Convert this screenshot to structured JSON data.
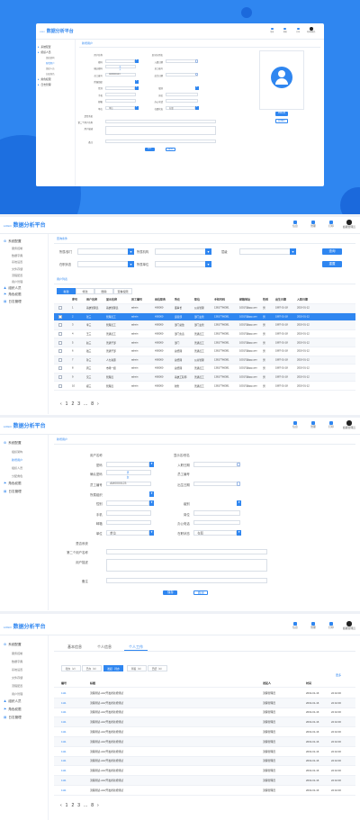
{
  "app": {
    "title": "数据分析平台",
    "title_prefix": "LOGO"
  },
  "header_icons": [
    {
      "icon": "message-icon",
      "label": "信息"
    },
    {
      "icon": "tools-icon",
      "label": "管理"
    },
    {
      "icon": "mail-icon",
      "label": "打印"
    },
    {
      "icon": "avatar",
      "label": "超级管理员"
    }
  ],
  "sidebar": [
    {
      "label": "系统配置",
      "icon": "gear-icon",
      "type": "group"
    },
    {
      "label": "服务控制",
      "type": "sub"
    },
    {
      "label": "数据字典",
      "type": "sub"
    },
    {
      "label": "系统设置",
      "type": "sub"
    },
    {
      "label": "文件存储",
      "type": "sub"
    },
    {
      "label": "流程配置",
      "type": "sub"
    },
    {
      "label": "用户管理",
      "type": "sub"
    },
    {
      "label": "组织人员",
      "icon": "users-icon",
      "type": "group"
    },
    {
      "label": "角色权限",
      "icon": "shield-icon",
      "type": "group"
    },
    {
      "label": "日志管理",
      "icon": "log-icon",
      "type": "group"
    }
  ],
  "sidebar_s3": [
    {
      "label": "系统配置",
      "icon": "gear-icon",
      "type": "group"
    },
    {
      "label": "组织架构",
      "type": "sub"
    },
    {
      "label": "新增用户",
      "type": "sub",
      "active": true
    },
    {
      "label": "组织人员",
      "type": "sub"
    },
    {
      "label": "分配角色",
      "type": "sub"
    },
    {
      "label": "角色权限",
      "icon": "shield-icon",
      "type": "group"
    },
    {
      "label": "日志管理",
      "icon": "log-icon",
      "type": "group"
    }
  ],
  "hero_sidebar": [
    {
      "label": "系统配置",
      "type": "group"
    },
    {
      "label": "组织人员",
      "type": "group"
    },
    {
      "label": "组织架构",
      "type": "sub"
    },
    {
      "label": "新增用户",
      "type": "sub",
      "active": true
    },
    {
      "label": "组织人员",
      "type": "sub"
    },
    {
      "label": "分配角色",
      "type": "sub"
    },
    {
      "label": "角色权限",
      "type": "group"
    },
    {
      "label": "日志管理",
      "type": "group"
    }
  ],
  "form": {
    "panel_title": "新增用户",
    "labels": {
      "user_id": "用户名称",
      "password": "密码",
      "confirm": "确认密码",
      "user_code": "员工编号",
      "pos_rank": "所属组织",
      "gender": "性别",
      "phone": "手机",
      "email": "邮箱",
      "org": "单位",
      "sys_admin": "是否系统",
      "alt_user": "第二个用户名称",
      "desc": "用户描述",
      "remark": "备注",
      "nick": "显示名/别名",
      "join": "入职日期",
      "emp_no": "员工编号",
      "birth": "出生日期",
      "level": "级别",
      "post": "岗位",
      "office": "办公电话",
      "addr": "地址",
      "status": "在职状态"
    },
    "values": {
      "user_code": "AM0000123",
      "status": "在职",
      "org": "单位"
    },
    "dd_text": {
      "a": "男",
      "b": "女"
    },
    "buttons": {
      "save": "保存",
      "cancel": "取消"
    },
    "avatar_buttons": {
      "upload": "更换头像",
      "choose": "选择图片"
    }
  },
  "search": {
    "panel_title": "查询条件",
    "fields": [
      {
        "label": "所属/部门"
      },
      {
        "label": "所属机构"
      },
      {
        "label": "层级"
      },
      {
        "label": "在职状态"
      },
      {
        "label": "所属单位"
      }
    ],
    "buttons": {
      "query": "查询",
      "reset": "重置"
    }
  },
  "list": {
    "panel_title": "用户列表",
    "tabs": [
      "新建",
      "修改",
      "删除",
      "查看权限"
    ],
    "columns": [
      "序号",
      "用户名称",
      "显示名称",
      "员工编号",
      "岗位职务",
      "所在",
      "职位",
      "手机号码",
      "邮箱地址",
      "性别",
      "出生日期",
      "入职日期"
    ],
    "rows": [
      [
        "1",
        "系统管理员",
        "系统管理员",
        "admin",
        "H00000",
        "董事长",
        "公共管理",
        "13817766381",
        "10017@jpg.com",
        "男",
        "1987-01-18",
        "2019-01-12"
      ],
      [
        "2",
        "张三",
        "管理员工",
        "admin",
        "H00000",
        "运营部",
        "部门主管",
        "13817766381",
        "10017@jpg.com",
        "男",
        "1987-01-18",
        "2019-01-12"
      ],
      [
        "3",
        "李三",
        "管理员工",
        "admin",
        "H00000",
        "部门总监",
        "部门主管",
        "13817766381",
        "10017@jpg.com",
        "男",
        "1987-01-18",
        "2019-01-12"
      ],
      [
        "4",
        "王三",
        "普通员工",
        "admin",
        "H00000",
        "部门负责",
        "普通员工",
        "13817766381",
        "10017@jpg.com",
        "男",
        "1987-01-18",
        "2019-01-12"
      ],
      [
        "5",
        "赵三",
        "普通干部",
        "admin",
        "H00000",
        "部门",
        "普通员工",
        "13817766381",
        "10017@jpg.com",
        "男",
        "1987-01-18",
        "2019-01-12"
      ],
      [
        "6",
        "钱三",
        "普通干部",
        "admin",
        "H00000",
        "总经理",
        "普通员工",
        "13817766381",
        "10017@jpg.com",
        "男",
        "1987-01-18",
        "2019-01-12"
      ],
      [
        "7",
        "孙三",
        "人力资源",
        "admin",
        "H00000",
        "总经理",
        "公共管理",
        "13817766381",
        "10017@jpg.com",
        "男",
        "1987-01-18",
        "2019-01-12"
      ],
      [
        "8",
        "周三",
        "市场一组",
        "admin",
        "H00000",
        "总经理",
        "普通员工",
        "13817766381",
        "10017@jpg.com",
        "男",
        "1987-01-18",
        "2019-01-12"
      ],
      [
        "9",
        "吴三",
        "管理员",
        "admin",
        "H00000",
        "系统工程师",
        "普通员工",
        "13817766381",
        "10017@jpg.com",
        "男",
        "1987-01-18",
        "2019-01-12"
      ],
      [
        "10",
        "郑三",
        "管理员",
        "admin",
        "H00000",
        "财务",
        "普通员工",
        "13817766381",
        "10017@jpg.com",
        "男",
        "1987-01-18",
        "2019-01-12"
      ]
    ],
    "pager": {
      "prev": "‹",
      "pages": [
        "1",
        "2",
        "3",
        "...",
        "8"
      ],
      "next": "›"
    }
  },
  "profile": {
    "tabs": [
      "基本信息",
      "个人信息",
      "个人工作"
    ],
    "filters": [
      "待办（2）",
      "已办（0）",
      "发起 · 待办",
      "草稿（0）",
      "已结（0）"
    ],
    "more": "更多",
    "columns": [
      "编号",
      "标题",
      "发起人",
      "时间"
    ],
    "rows": [
      [
        "1111",
        "流程测试-cd2/开发者新增测试",
        "流程管理员",
        "2019-01-16",
        "22:42:30"
      ],
      [
        "1111",
        "流程测试-cd2/开发者新增测试",
        "流程管理员",
        "2019-01-16",
        "22:42:30"
      ],
      [
        "1111",
        "流程测试-cd2/开发者新增测试",
        "流程管理员",
        "2019-01-16",
        "22:42:30"
      ],
      [
        "1111",
        "流程测试-cd2/开发者新增测试",
        "流程管理员",
        "2019-01-16",
        "22:42:30"
      ],
      [
        "1111",
        "流程测试-cd2/开发者新增测试",
        "流程管理员",
        "2019-01-16",
        "22:42:30"
      ],
      [
        "1111",
        "流程测试-cd2/开发者新增测试",
        "流程管理员",
        "2019-01-16",
        "22:42:30"
      ],
      [
        "1111",
        "流程测试-cd2/开发者新增测试",
        "流程管理员",
        "2019-01-16",
        "22:42:30"
      ],
      [
        "1111",
        "流程测试-cd2/开发者新增测试",
        "流程管理员",
        "2019-01-16",
        "22:42:30"
      ],
      [
        "1111",
        "流程测试-cd2/开发者新增测试",
        "流程管理员",
        "2019-01-16",
        "22:42:30"
      ],
      [
        "1111",
        "流程测试-cd2/开发者新增测试",
        "流程管理员",
        "2019-01-16",
        "22:42:30"
      ],
      [
        "1111",
        "流程测试-cd2/开发者新增测试",
        "流程管理员",
        "2019-01-16",
        "22:42:30"
      ]
    ],
    "pager": {
      "prev": "‹",
      "pages": [
        "1",
        "2",
        "3",
        "...",
        "8"
      ],
      "next": "›"
    }
  },
  "colors": {
    "accent": "#2f86f0",
    "hero": "#2f86f0"
  }
}
